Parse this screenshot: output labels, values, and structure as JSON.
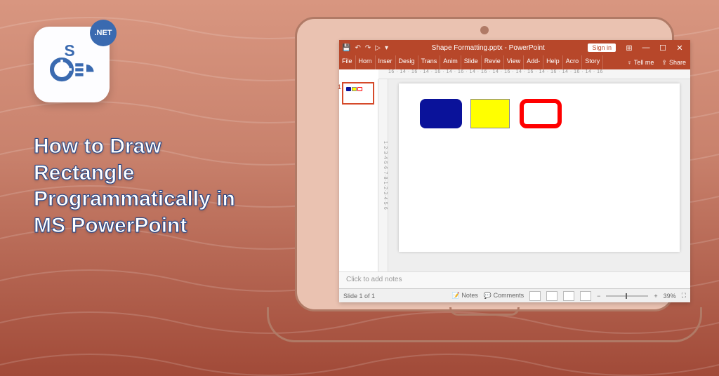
{
  "badge": {
    "text": ".NET"
  },
  "headline": "How to Draw Rectangle Programmatically in MS PowerPoint",
  "ppt": {
    "title": "Shape Formatting.pptx - PowerPoint",
    "signin": "Sign in",
    "qat": {
      "save": "💾",
      "undo": "↶",
      "redo": "↷",
      "start": "▷",
      "more": "▾"
    },
    "wc": {
      "ribbon": "⊞",
      "min": "—",
      "max": "☐",
      "close": "✕"
    },
    "tabs": [
      "File",
      "Hom",
      "Inser",
      "Desig",
      "Trans",
      "Anim",
      "Slide",
      "Revie",
      "View",
      "Add-",
      "Help",
      "Acro",
      "Story"
    ],
    "tellme": "Tell me",
    "share": "Share",
    "ruler_h": "16 · 14 · 16 · 14 · 16 · 14 · 16 · 14 · 16 · 14 · 16 · 14 · 16 · 14 · 16 · 14 · 16 · 14 · 16",
    "ruler_v": "1·2·3·4·5·6·7·8·1·2·3·4·5·6",
    "thumb_number": "1",
    "notes_placeholder": "Click to add notes",
    "status": {
      "slide": "Slide 1 of 1",
      "notes": "Notes",
      "comments": "Comments",
      "zoom_minus": "−",
      "zoom_plus": "+",
      "zoom_value": "39%",
      "fit": "⛶"
    }
  }
}
